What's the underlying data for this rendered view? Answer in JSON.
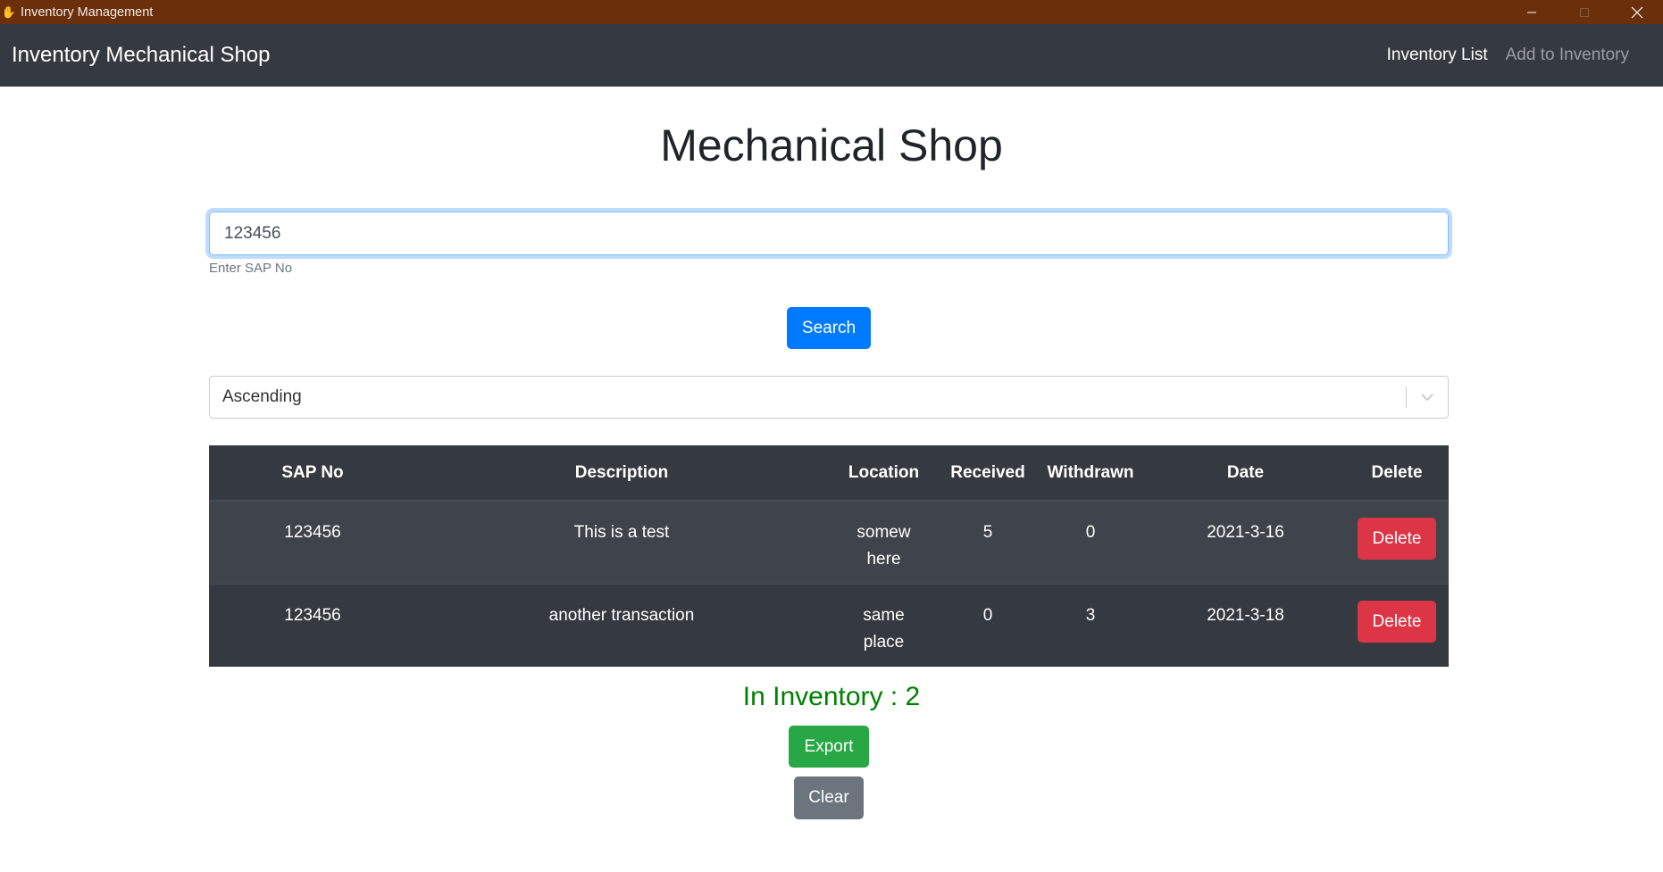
{
  "window": {
    "title": "Inventory Management",
    "icon": "app-hand-icon",
    "controls": [
      "minimize",
      "maximize",
      "close"
    ]
  },
  "navbar": {
    "brand": "Inventory Mechanical Shop",
    "links": [
      {
        "label": "Inventory List",
        "active": true
      },
      {
        "label": "Add to Inventory",
        "active": false
      }
    ]
  },
  "page": {
    "title": "Mechanical Shop"
  },
  "search": {
    "value": "123456",
    "help_text": "Enter SAP No",
    "button_label": "Search"
  },
  "sort": {
    "selected": "Ascending"
  },
  "table": {
    "columns": [
      "SAP No",
      "Description",
      "Location",
      "Received",
      "Withdrawn",
      "Date",
      "Delete"
    ],
    "rows": [
      {
        "sap_no": "123456",
        "description": "This is a test",
        "location": "somewhere",
        "received": "5",
        "withdrawn": "0",
        "date": "2021-3-16",
        "action": "Delete"
      },
      {
        "sap_no": "123456",
        "description": "another transaction",
        "location": "same place",
        "received": "0",
        "withdrawn": "3",
        "date": "2021-3-18",
        "action": "Delete"
      }
    ]
  },
  "summary": {
    "in_inventory": "In Inventory : 2"
  },
  "actions": {
    "export_label": "Export",
    "clear_label": "Clear"
  },
  "colors": {
    "titlebar": "#6b2f0c",
    "navbar": "#343a40",
    "primary": "#007bff",
    "danger": "#dc3545",
    "success": "#28a745",
    "secondary": "#6c757d",
    "inventory_text": "#008000"
  }
}
